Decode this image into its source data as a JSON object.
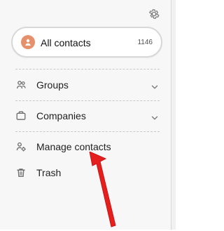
{
  "ui": {
    "all_contacts": {
      "label": "All contacts",
      "count": "1146"
    },
    "nav": {
      "groups": "Groups",
      "companies": "Companies",
      "manage_contacts": "Manage contacts",
      "trash": "Trash"
    }
  },
  "icons": {
    "settings": "gear-icon",
    "avatar": "person-icon",
    "groups": "groups-icon",
    "companies": "briefcase-icon",
    "manage_contacts": "manage-contacts-icon",
    "trash": "trash-icon",
    "expand": "chevron-down-icon",
    "pointer": "red-arrow-icon"
  },
  "colors": {
    "background": "#f7f7f7",
    "card": "#ffffff",
    "avatar": "#e7906c",
    "arrow": "#e51e1e",
    "text": "#1f1f1f",
    "muted": "#4f4f4f"
  }
}
